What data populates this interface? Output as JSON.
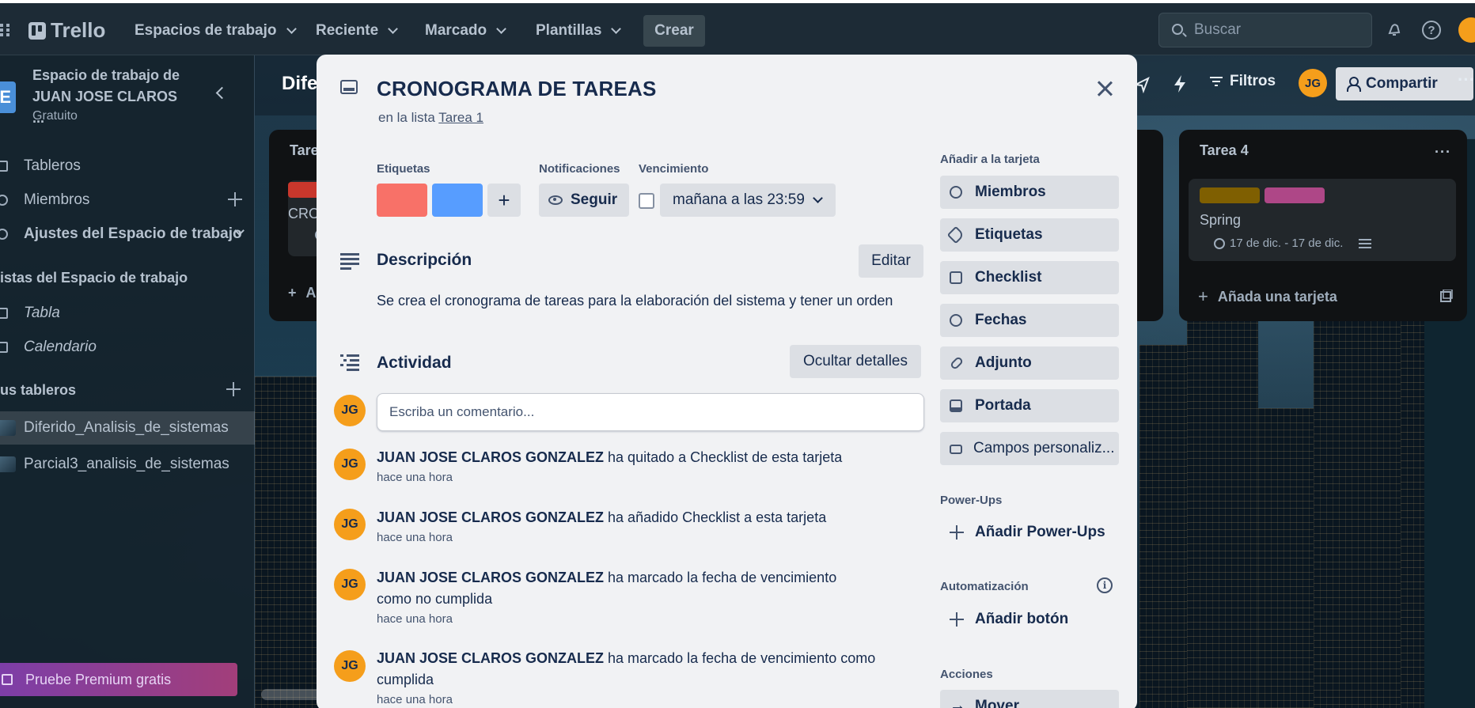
{
  "topbar": {
    "logo": "Trello",
    "nav": [
      {
        "label": "Espacios de trabajo"
      },
      {
        "label": "Reciente"
      },
      {
        "label": "Marcado"
      },
      {
        "label": "Plantillas"
      }
    ],
    "create_label": "Crear",
    "search_placeholder": "Buscar"
  },
  "sidebar": {
    "workspace_initial": "E",
    "workspace_name": "Espacio de trabajo de JUAN JOSE CLAROS ...",
    "workspace_plan": "Gratuito",
    "items": [
      {
        "label": "Tableros"
      },
      {
        "label": "Miembros"
      },
      {
        "label": "Ajustes del Espacio de trabajo"
      }
    ],
    "views_heading": "istas del Espacio de trabajo",
    "views": [
      {
        "label": "Tabla"
      },
      {
        "label": "Calendario"
      }
    ],
    "boards_heading": "us tableros",
    "boards": [
      {
        "label": "Diferido_Analisis_de_sistemas",
        "selected": true
      },
      {
        "label": "Parcial3_analisis_de_sistemas",
        "selected": false
      }
    ],
    "premium_label": "Pruebe Premium gratis"
  },
  "board": {
    "title": "Dife",
    "filters_label": "Filtros",
    "member_initials": "JG",
    "share_label": "Compartir",
    "lists": [
      {
        "title": "Tare",
        "card_text": "CRO",
        "add_label": "A"
      },
      {
        "title": "Tarea 4",
        "card_text": "Spring",
        "card_dates": "17 de dic. - 17 de dic.",
        "add_label": "Añada una tarjeta",
        "menu": "···"
      }
    ]
  },
  "modal": {
    "title": "CRONOGRAMA DE TAREAS",
    "in_list_prefix": "en la lista",
    "in_list_link": "Tarea 1",
    "labels_heading": "Etiquetas",
    "label_colors": [
      "#f87168",
      "#579dff"
    ],
    "notifications_heading": "Notificaciones",
    "follow_label": "Seguir",
    "due_heading": "Vencimiento",
    "due_value": "mañana a las 23:59",
    "description_heading": "Descripción",
    "edit_label": "Editar",
    "description_text": "Se crea el cronograma de tareas para la elaboración del sistema y tener un orden",
    "activity_heading": "Actividad",
    "hide_details_label": "Ocultar detalles",
    "comment_placeholder": "Escriba un comentario...",
    "user_initials": "JG",
    "activities": [
      {
        "user": "JUAN JOSE CLAROS GONZALEZ",
        "text": " ha quitado a Checklist de esta tarjeta",
        "time": "hace una hora"
      },
      {
        "user": "JUAN JOSE CLAROS GONZALEZ",
        "text": " ha añadido Checklist a esta tarjeta",
        "time": "hace una hora"
      },
      {
        "user": "JUAN JOSE CLAROS GONZALEZ",
        "text": " ha marcado la fecha de vencimiento como no cumplida",
        "time": "hace una hora"
      },
      {
        "user": "JUAN JOSE CLAROS GONZALEZ",
        "text": " ha marcado la fecha de vencimiento como cumplida",
        "time": "hace una hora"
      }
    ],
    "add_to_card_heading": "Añadir a la tarjeta",
    "add_to_card": [
      {
        "label": "Miembros",
        "icon": "person-icon"
      },
      {
        "label": "Etiquetas",
        "icon": "tag-icon"
      },
      {
        "label": "Checklist",
        "icon": "checklist-icon"
      },
      {
        "label": "Fechas",
        "icon": "clock-icon"
      },
      {
        "label": "Adjunto",
        "icon": "paperclip-icon"
      },
      {
        "label": "Portada",
        "icon": "cover-icon"
      },
      {
        "label": "Campos personaliz...",
        "icon": "custom-fields-icon"
      }
    ],
    "powerups_heading": "Power-Ups",
    "add_powerups_label": "Añadir Power-Ups",
    "automation_heading": "Automatización",
    "add_button_label": "Añadir botón",
    "actions_heading": "Acciones",
    "move_label": "Mover"
  }
}
